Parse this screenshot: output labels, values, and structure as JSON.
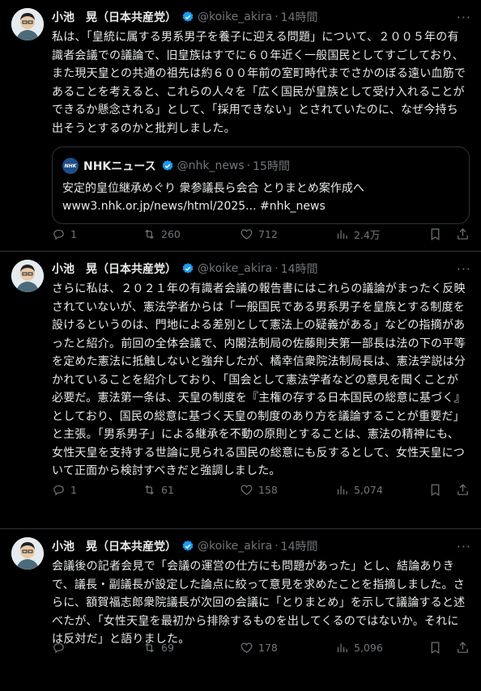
{
  "tweets": [
    {
      "name": "小池　晃（日本共産党）",
      "handle": "@koike_akira",
      "dot": "·",
      "time": "14時間",
      "text": "私は、「皇統に属する男系男子を養子に迎える問題」について、２００５年の有識者会議での議論で、旧皇族はすでに６０年近く一般国民としてすごしており、また現天皇との共通の祖先は約６００年前の室町時代までさかのぼる遠い血筋であることを考えると、これらの人々を「広く国民が皇族として受け入れることができるか懸念される」として、「採用できない」とされていたのに、なぜ今持ち出そうとするのかと批判しました。",
      "quote": {
        "logo": "NHK",
        "name": "NHKニュース",
        "handle": "@nhk_news",
        "dot": "·",
        "time": "15時間",
        "text": "安定的皇位継承めぐり 衆参議長ら会合 とりまとめ案作成へ\nwww3.nhk.or.jp/news/html/2025... #nhk_news"
      },
      "replies": "1",
      "retweets": "260",
      "likes": "712",
      "views": "2.4万"
    },
    {
      "name": "小池　晃（日本共産党）",
      "handle": "@koike_akira",
      "dot": "·",
      "time": "14時間",
      "text": "さらに私は、２０２１年の有識者会議の報告書にはこれらの議論がまったく反映されていないが、憲法学者からは「一般国民である男系男子を皇族とする制度を設けるというのは、門地による差別として憲法上の疑義がある」などの指摘があったと紹介。前回の全体会議で、内閣法制局の佐藤則夫第一部長は法の下の平等を定めた憲法に抵触しないと強弁したが、橘幸信衆院法制局長は、憲法学説は分かれていることを紹介しており、「国会として憲法学者などの意見を聞くことが必要だ。憲法第一条は、天皇の制度を『主権の存する日本国民の総意に基づく』としており、国民の総意に基づく天皇の制度のあり方を議論することが重要だ」と主張。「男系男子」による継承を不動の原則とすることは、憲法の精神にも、女性天皇を支持する世論に見られる国民の総意にも反するとして、女性天皇について正面から検討すべきだと強調しました。",
      "replies": "1",
      "retweets": "61",
      "likes": "158",
      "views": "5,074"
    },
    {
      "name": "小池　晃（日本共産党）",
      "handle": "@koike_akira",
      "dot": "·",
      "time": "14時間",
      "text": "会議後の記者会見で「会議の運営の仕方にも問題があった」とし、結論ありきで、議長・副議長が設定した論点に絞って意見を求めたことを指摘しました。さらに、額賀福志郎衆院議長が次回の会議に「とりまとめ」を示して議論すると述べたが、「女性天皇を最初から排除するものを出してくるのではないか。それには反対だ」と語りました。",
      "replies": "",
      "retweets": "69",
      "likes": "178",
      "views": "5,096"
    }
  ],
  "icons": {
    "more": "more-icon",
    "reply": "reply-icon",
    "retweet": "retweet-icon",
    "like": "like-icon",
    "views": "views-icon",
    "bookmark": "bookmark-icon",
    "share": "share-icon",
    "verified": "verified-badge-icon"
  },
  "colors": {
    "background": "#000000",
    "text": "#e7e9ea",
    "muted": "#71767b",
    "verified": "#1d9bf0",
    "border": "#2f3336"
  }
}
